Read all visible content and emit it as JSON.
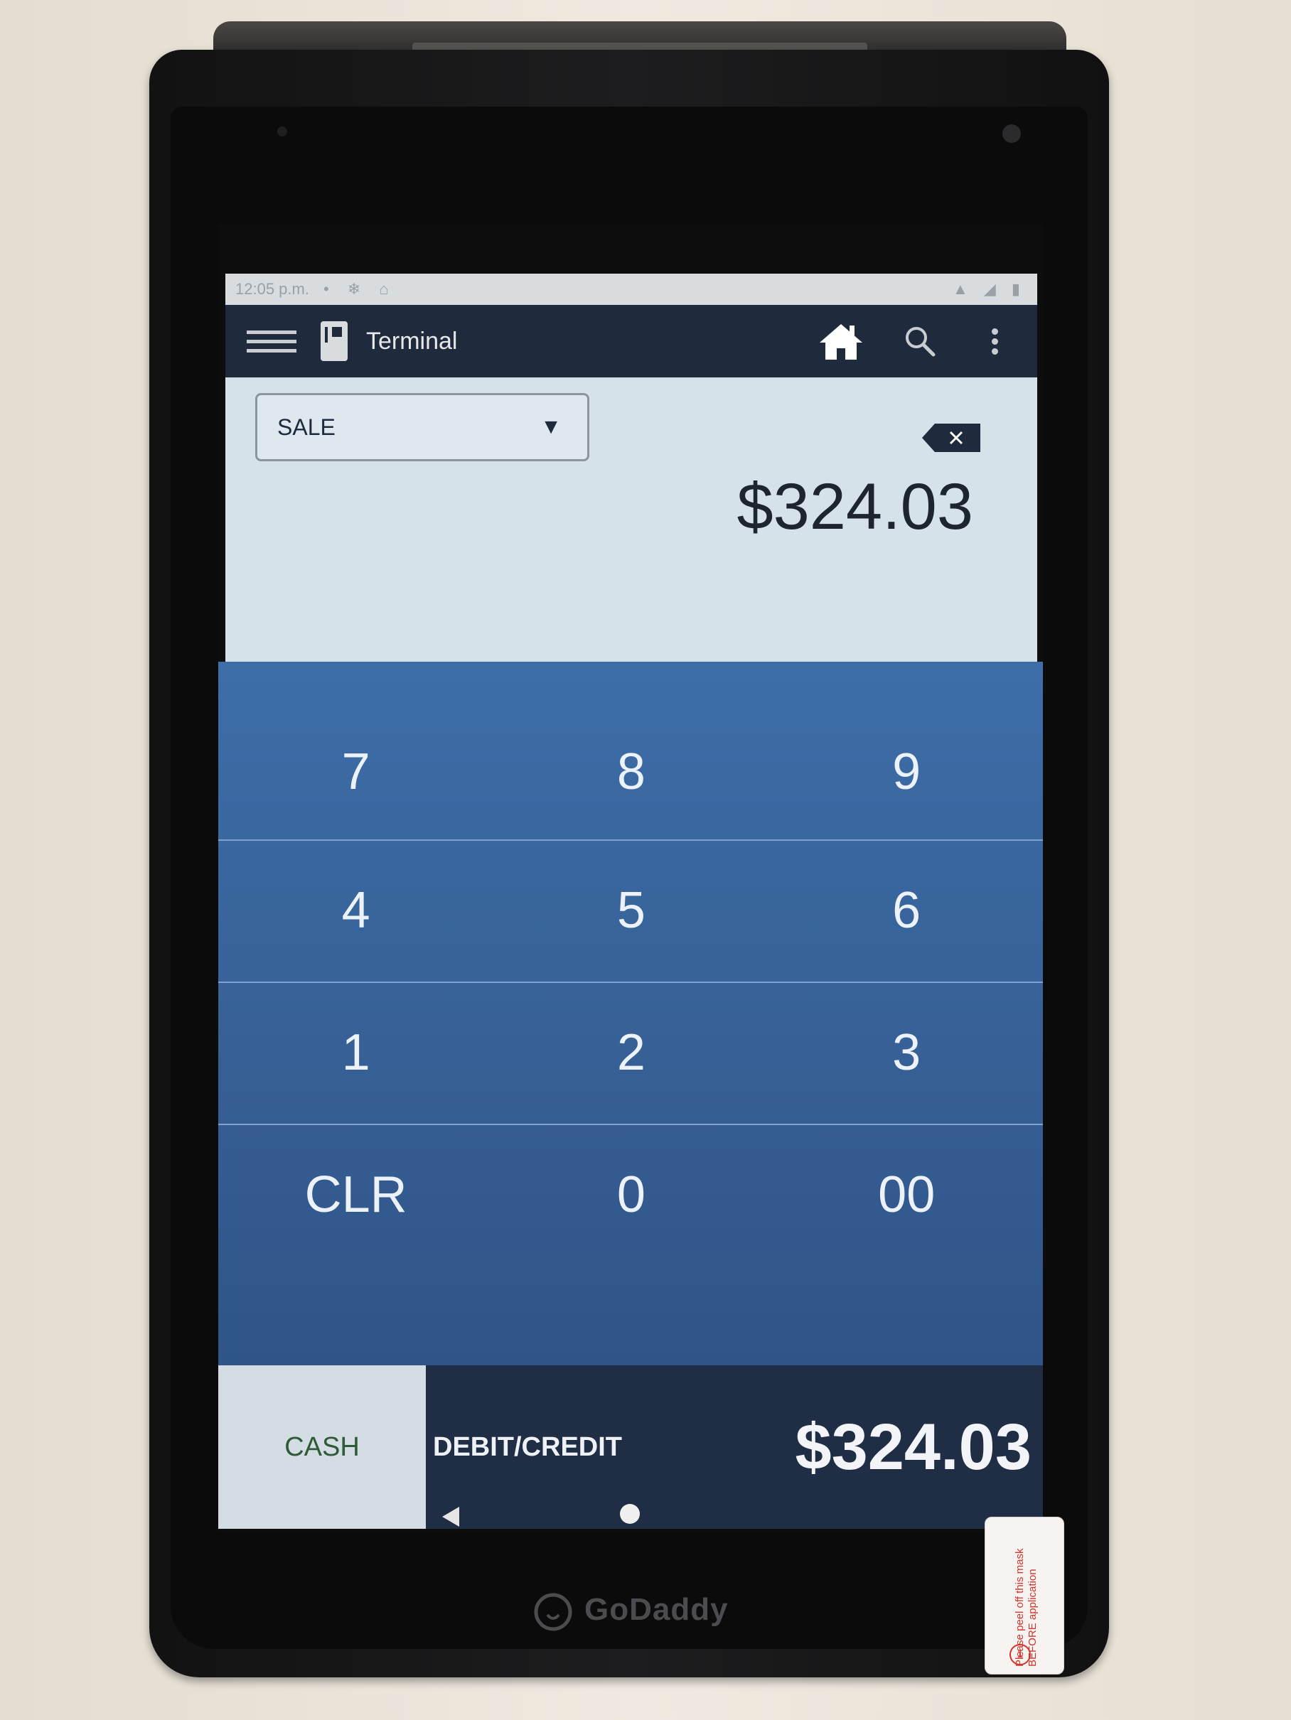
{
  "status_bar": {
    "time": "12:05 p.m.",
    "left_icons": "• ❄ ⌂",
    "right_icons": "▲ ◢ ▮"
  },
  "app_bar": {
    "title": "Terminal",
    "icons": [
      "menu-icon",
      "terminal-icon",
      "home-icon",
      "search-icon",
      "overflow-menu-icon"
    ]
  },
  "transaction": {
    "type_selected": "SALE",
    "amount": "$324.03"
  },
  "keypad": {
    "rows": [
      [
        "7",
        "8",
        "9"
      ],
      [
        "4",
        "5",
        "6"
      ],
      [
        "1",
        "2",
        "3"
      ],
      [
        "CLR",
        "0",
        "00"
      ]
    ]
  },
  "payment": {
    "cash_label": "CASH",
    "card_label": "DEBIT/CREDIT",
    "total": "$324.03"
  },
  "device": {
    "brand": "GoDaddy",
    "sticker_text": "Please peel off this mask BEFORE application",
    "sticker_number": "1"
  },
  "colors": {
    "app_bar": "#1f2b3d",
    "keypad_blue": "#3a67a0",
    "cash_text": "#2e5a36",
    "bottom_bar": "#1f2d45"
  }
}
